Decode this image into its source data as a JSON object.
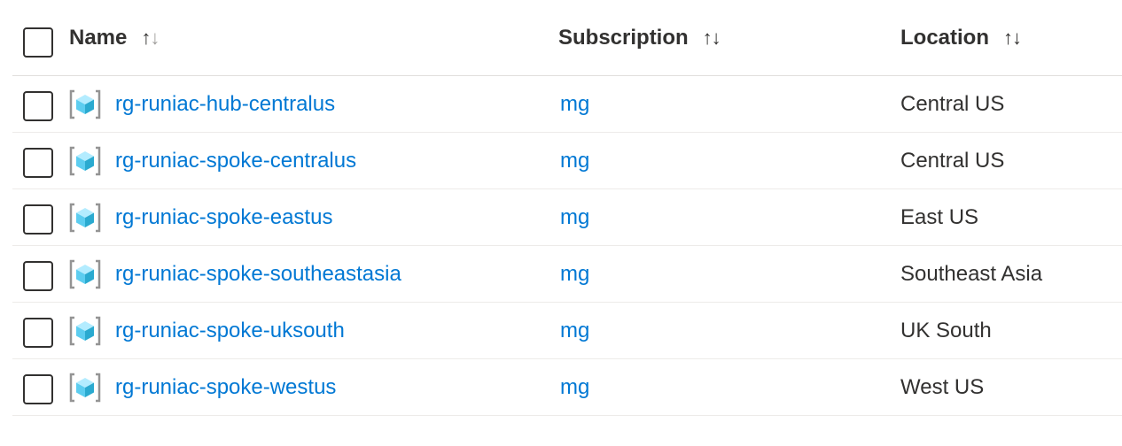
{
  "header": {
    "name_label": "Name",
    "subscription_label": "Subscription",
    "location_label": "Location",
    "sort_up_glyph": "↑",
    "sort_down_glyph": "↓"
  },
  "rows": [
    {
      "name": "rg-runiac-hub-centralus",
      "subscription": "mg",
      "location": "Central US"
    },
    {
      "name": "rg-runiac-spoke-centralus",
      "subscription": "mg",
      "location": "Central US"
    },
    {
      "name": "rg-runiac-spoke-eastus",
      "subscription": "mg",
      "location": "East US"
    },
    {
      "name": "rg-runiac-spoke-southeastasia",
      "subscription": "mg",
      "location": "Southeast Asia"
    },
    {
      "name": "rg-runiac-spoke-uksouth",
      "subscription": "mg",
      "location": "UK South"
    },
    {
      "name": "rg-runiac-spoke-westus",
      "subscription": "mg",
      "location": "West US"
    }
  ],
  "icons": {
    "resource_group": "resource-group-icon"
  },
  "colors": {
    "link": "#0078d4",
    "text": "#323130",
    "icon_cube_light": "#7fdcff",
    "icon_cube_dark": "#32bedd",
    "icon_bracket": "#949494"
  }
}
